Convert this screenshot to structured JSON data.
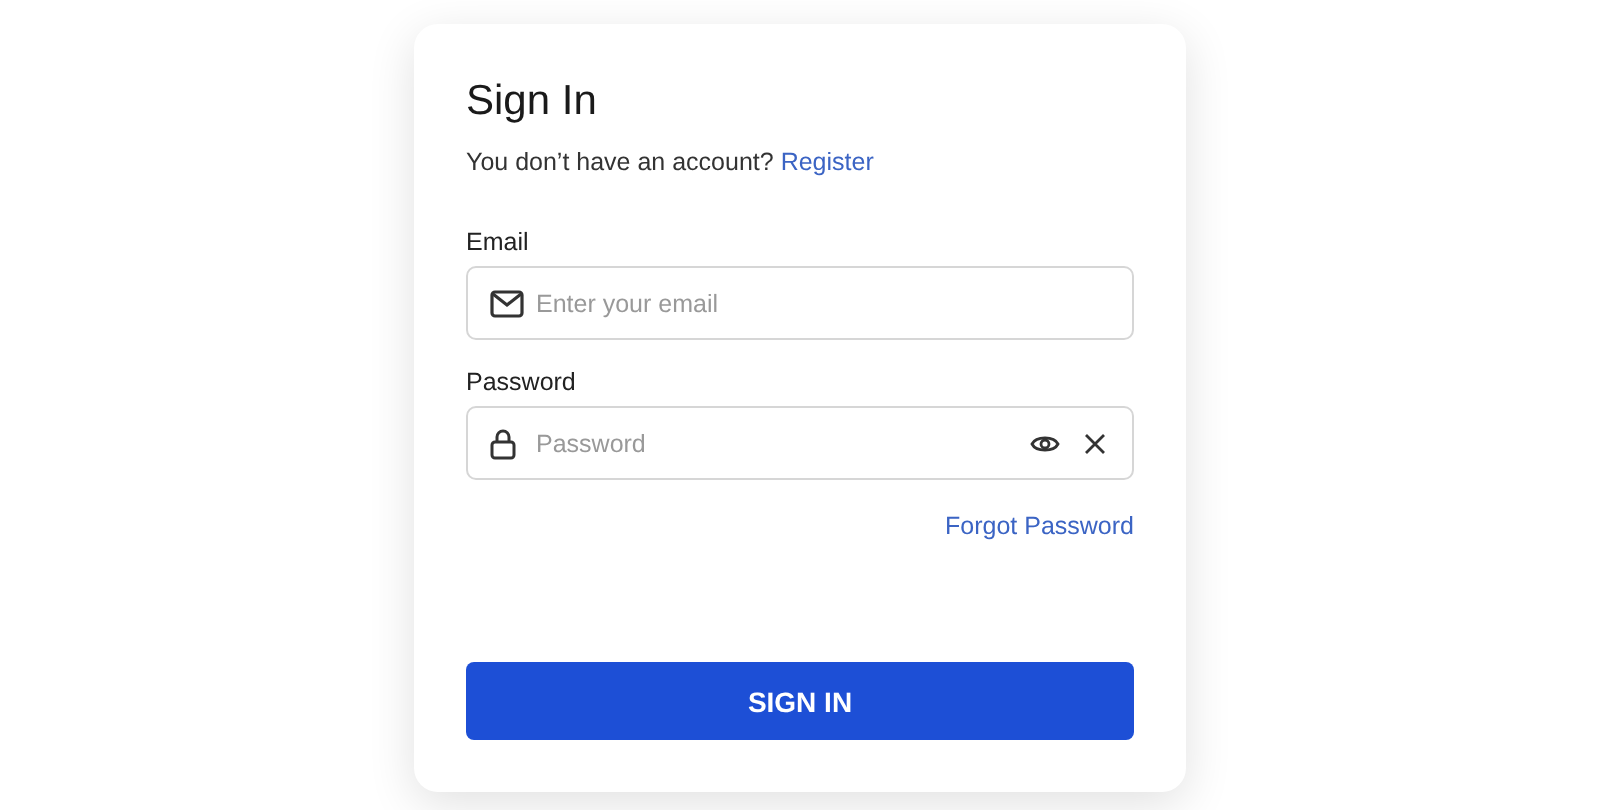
{
  "title": "Sign In",
  "register_prompt": {
    "text": "You don’t have an account?",
    "link": "Register"
  },
  "fields": [
    {
      "kind": "email",
      "label": "Email",
      "placeholder": "Enter your email"
    },
    {
      "kind": "password",
      "label": "Password",
      "placeholder": "Password"
    }
  ],
  "forgot_link": "Forgot Password",
  "submit_button": "SIGN IN"
}
